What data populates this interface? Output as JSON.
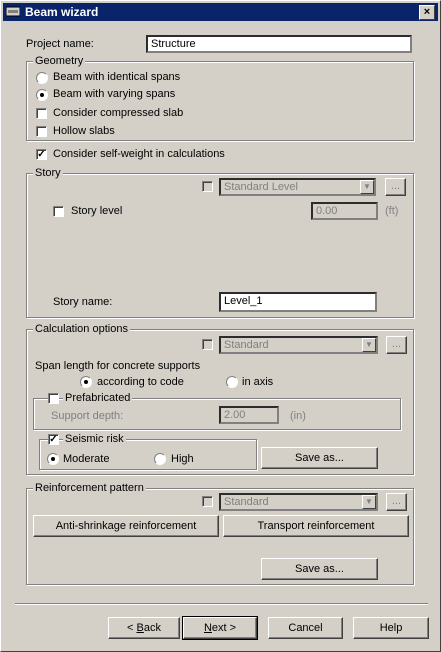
{
  "window": {
    "title": "Beam wizard",
    "close": "×"
  },
  "project": {
    "label": "Project name:",
    "value": "Structure"
  },
  "geometry": {
    "title": "Geometry",
    "identical": "Beam with identical spans",
    "varying": "Beam with varying spans",
    "compressed": "Consider compressed slab",
    "hollow": "Hollow slabs"
  },
  "selfweight": {
    "label": "Consider self-weight in calculations",
    "check": "✓"
  },
  "story": {
    "title": "Story",
    "combo": "Standard Level",
    "more": "...",
    "level_label": "Story level",
    "level_value": "0.00",
    "level_unit": "(ft)",
    "name_label": "Story name:",
    "name_value": "Level_1"
  },
  "calc": {
    "title": "Calculation options",
    "combo": "Standard",
    "more": "...",
    "span_label": "Span length for concrete supports",
    "code": "according to code",
    "axis": "in axis",
    "prefab": "Prefabricated",
    "support_label": "Support depth:",
    "support_value": "2.00",
    "support_unit": "(in)",
    "seismic": "Seismic risk",
    "moderate": "Moderate",
    "high": "High",
    "saveas": "Save as..."
  },
  "reinf": {
    "title": "Reinforcement pattern",
    "combo": "Standard",
    "more": "...",
    "anti": "Anti-shrinkage reinforcement",
    "transport": "Transport reinforcement",
    "saveas": "Save as..."
  },
  "footer": {
    "back_u": "B",
    "back_rest": "ack",
    "back_prefix": "< ",
    "next_u": "N",
    "next_rest": "ext >",
    "cancel": "Cancel",
    "help": "Help"
  },
  "colors": {
    "titlebar": "#0a246a",
    "face": "#d4d0c8"
  }
}
